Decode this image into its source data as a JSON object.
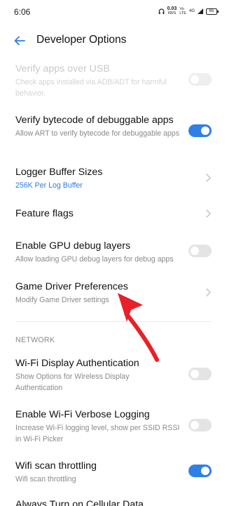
{
  "status_bar": {
    "time": "6:06",
    "net_speed": "0.03",
    "net_unit": "KB/S",
    "volte": "Vo\nLTE",
    "signal": "4G",
    "battery": "65"
  },
  "header": {
    "title": "Developer Options"
  },
  "items": {
    "verify_usb": {
      "title": "Verify apps over USB",
      "subtitle": "Check apps installed via ADB/ADT for harmful behavior.",
      "toggle": false
    },
    "verify_bytecode": {
      "title": "Verify bytecode of debuggable apps",
      "subtitle": "Allow ART to verify bytecode for debuggable apps",
      "toggle": true
    },
    "logger_buffer": {
      "title": "Logger Buffer Sizes",
      "subtitle": "256K Per Log Buffer"
    },
    "feature_flags": {
      "title": "Feature flags"
    },
    "gpu_debug": {
      "title": "Enable GPU debug layers",
      "subtitle": "Allow loading GPU debug layers for debug apps",
      "toggle": false
    },
    "game_driver": {
      "title": "Game Driver Preferences",
      "subtitle": "Modify Game Driver settings"
    },
    "wifi_display_auth": {
      "title": "Wi-Fi Display Authentication",
      "subtitle": "Show Options for Wireless Display Authentication",
      "toggle": false
    },
    "wifi_verbose": {
      "title": "Enable Wi-Fi Verbose Logging",
      "subtitle": "Increase Wi-Fi logging level, show per SSID RSSI in Wi-Fi Picker",
      "toggle": false
    },
    "wifi_throttling": {
      "title": "Wifi scan throttling",
      "subtitle": "Wifi scan throttling",
      "toggle": true
    },
    "cellular_data": {
      "title": "Always Turn on Cellular Data"
    }
  },
  "sections": {
    "network": "NETWORK"
  },
  "colors": {
    "accent": "#2f7fe6",
    "annotation_arrow": "#e8202a"
  },
  "icons": {
    "back": "arrow-left-icon",
    "chevron": "chevron-right-icon"
  }
}
